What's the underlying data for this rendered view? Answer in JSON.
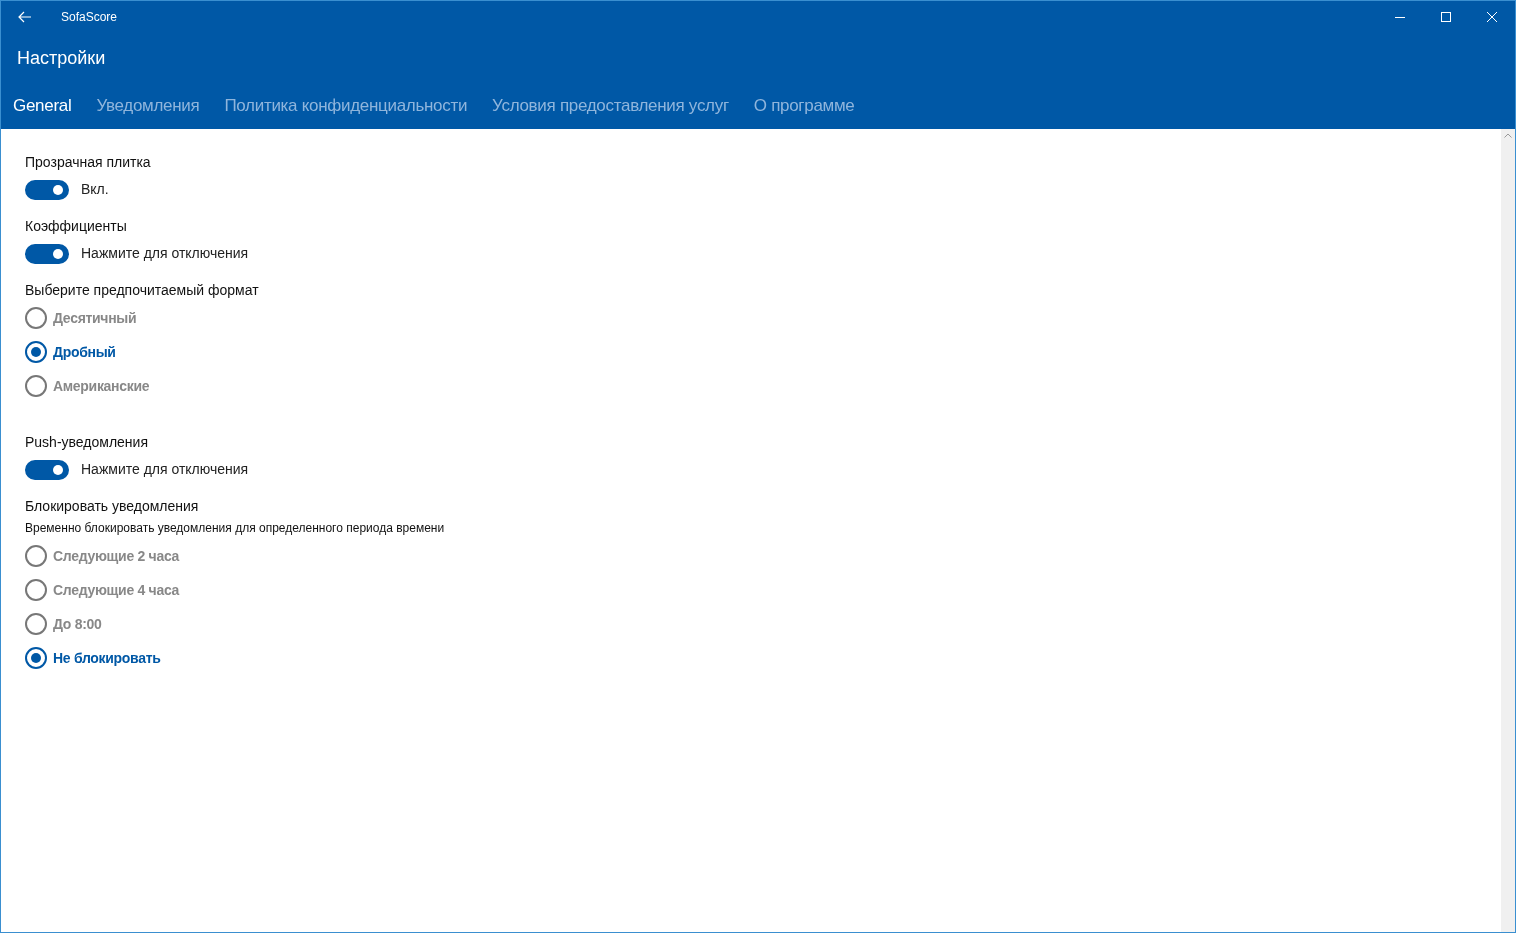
{
  "window": {
    "title": "SofaScore"
  },
  "page_title": "Настройки",
  "tabs": [
    {
      "label": "General",
      "selected": true
    },
    {
      "label": "Уведомления",
      "selected": false
    },
    {
      "label": "Политика конфиденциальности",
      "selected": false
    },
    {
      "label": "Условия предоставления услуг",
      "selected": false
    },
    {
      "label": "О программе",
      "selected": false
    }
  ],
  "sections": [
    {
      "kind": "toggle",
      "title": "Прозрачная плитка",
      "on": true,
      "label": "Вкл."
    },
    {
      "kind": "toggle",
      "title": "Коэффициенты",
      "on": true,
      "label": "Нажмите для отключения"
    },
    {
      "kind": "radio",
      "title": "Выберите предпочитаемый формат",
      "options": [
        {
          "label": "Десятичный",
          "selected": false
        },
        {
          "label": "Дробный",
          "selected": true
        },
        {
          "label": "Американские",
          "selected": false
        }
      ]
    },
    {
      "kind": "toggle",
      "title": "Push-уведомления",
      "on": true,
      "label": "Нажмите для отключения"
    },
    {
      "kind": "radio",
      "title": "Блокировать уведомления",
      "description": "Временно блокировать уведомления для определенного периода времени",
      "options": [
        {
          "label": "Следующие 2 часа",
          "selected": false
        },
        {
          "label": "Следующие 4 часа",
          "selected": false
        },
        {
          "label": "До 8:00",
          "selected": false
        },
        {
          "label": "Не блокировать",
          "selected": true
        }
      ]
    }
  ]
}
